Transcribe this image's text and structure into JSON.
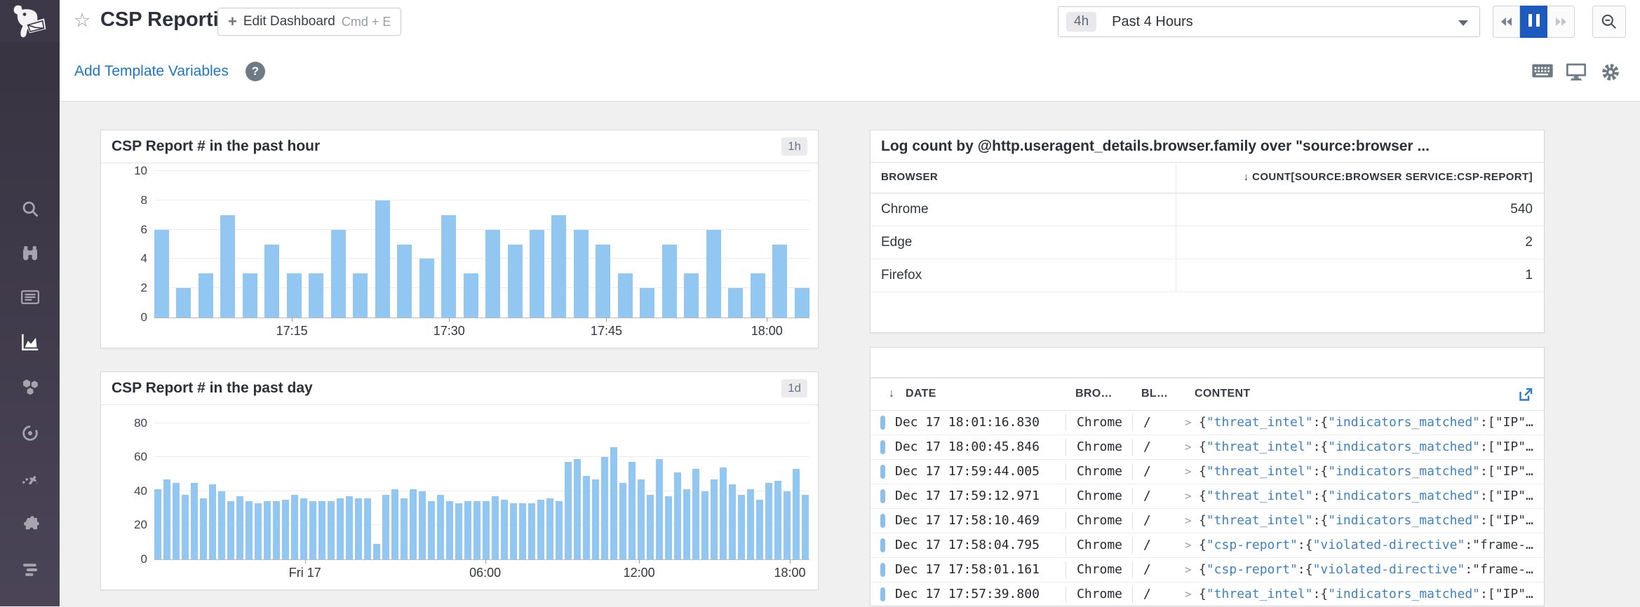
{
  "colors": {
    "accent_link_blue": "#1f77c2",
    "pause_active_blue": "#1d5abe",
    "chart_bar_blue": "#92c7f2",
    "log_key_blue": "#3d82c4",
    "log_level_bar_blue": "#8cc0ea",
    "sidebar_bg": "#3c3847"
  },
  "sidebar": {
    "items": [
      {
        "icon": "search-icon"
      },
      {
        "icon": "watchdog-binoculars-icon"
      },
      {
        "icon": "events-list-icon"
      },
      {
        "icon": "dashboards-chart-icon",
        "active": true
      },
      {
        "icon": "infrastructure-hexagons-icon"
      },
      {
        "icon": "apm-icon"
      },
      {
        "icon": "metrics-gauge-icon"
      },
      {
        "icon": "integrations-puzzle-icon"
      },
      {
        "icon": "logs-icon"
      }
    ]
  },
  "header": {
    "title": "CSP Reporting",
    "edit_button": {
      "plus": "+",
      "label": "Edit Dashboard",
      "shortcut": "Cmd + E"
    },
    "time_picker": {
      "badge": "4h",
      "label": "Past 4 Hours"
    }
  },
  "subheader": {
    "template_link": "Add Template Variables",
    "help": "?"
  },
  "chart_data": [
    {
      "type": "bar",
      "title": "CSP Report # in the past hour",
      "badge": "1h",
      "values": [
        6,
        2,
        3,
        7,
        3,
        5,
        3,
        3,
        6,
        3,
        8,
        5,
        4,
        7,
        3,
        6,
        5,
        6,
        7,
        6,
        5,
        3,
        2,
        5,
        3,
        6,
        2,
        3,
        5,
        2
      ],
      "ylim": [
        0,
        10
      ],
      "yticks": [
        0,
        2,
        4,
        6,
        8,
        10
      ],
      "xticks": [
        {
          "label": "17:15",
          "pos": 0.21
        },
        {
          "label": "17:30",
          "pos": 0.45
        },
        {
          "label": "17:45",
          "pos": 0.69
        },
        {
          "label": "18:00",
          "pos": 0.935
        }
      ],
      "grid": true,
      "legend": false
    },
    {
      "type": "bar",
      "title": "CSP Report # in the past day",
      "badge": "1d",
      "values": [
        41,
        47,
        45,
        38,
        45,
        36,
        44,
        40,
        34,
        37,
        34,
        33,
        34,
        34,
        35,
        38,
        36,
        34,
        34,
        34,
        36,
        37,
        36,
        36,
        9,
        38,
        41,
        36,
        41,
        40,
        34,
        38,
        34,
        33,
        34,
        34,
        34,
        37,
        35,
        33,
        33,
        33,
        35,
        36,
        34,
        57,
        59,
        49,
        47,
        60,
        66,
        45,
        57,
        47,
        38,
        59,
        37,
        51,
        41,
        53,
        40,
        47,
        54,
        44,
        38,
        41,
        35,
        45,
        46,
        40,
        53,
        38
      ],
      "ylim": [
        0,
        86
      ],
      "yticks": [
        0,
        20,
        40,
        60,
        80
      ],
      "xticks": [
        {
          "label": "Fri 17",
          "pos": 0.23
        },
        {
          "label": "06:00",
          "pos": 0.505
        },
        {
          "label": "12:00",
          "pos": 0.74
        },
        {
          "label": "18:00",
          "pos": 0.97
        }
      ],
      "grid": true,
      "legend": false
    }
  ],
  "table_panel": {
    "title": "Log count by @http.useragent_details.browser.family over \"source:browser ...",
    "sort_icon": "↓",
    "columns": [
      "BROWSER",
      "COUNT[SOURCE:BROWSER SERVICE:CSP-REPORT]"
    ],
    "rows": [
      {
        "browser": "Chrome",
        "count": "540"
      },
      {
        "browser": "Edge",
        "count": "2"
      },
      {
        "browser": "Firefox",
        "count": "1"
      }
    ]
  },
  "log_panel": {
    "sort_icon": "↓",
    "columns": {
      "date": "DATE",
      "browser": "BRO…",
      "blocked": "BL…",
      "content": "CONTENT"
    },
    "row_chevron": ">",
    "content_templates": {
      "threat_intel": [
        {
          "text": "{",
          "style": "p"
        },
        {
          "text": "\"threat_intel\"",
          "style": "k"
        },
        {
          "text": ":{",
          "style": "p"
        },
        {
          "text": "\"indicators_matched\"",
          "style": "k"
        },
        {
          "text": ":[",
          "style": "p"
        },
        {
          "text": "\"IP\"",
          "style": "p"
        },
        {
          "text": "…",
          "style": "p"
        }
      ],
      "csp_report": [
        {
          "text": "{",
          "style": "p"
        },
        {
          "text": "\"csp-report\"",
          "style": "k"
        },
        {
          "text": ":{",
          "style": "p"
        },
        {
          "text": "\"violated-directive\"",
          "style": "k"
        },
        {
          "text": ":",
          "style": "p"
        },
        {
          "text": "\"frame-",
          "style": "p"
        },
        {
          "text": "…",
          "style": "p"
        }
      ]
    },
    "rows": [
      {
        "date": "Dec 17 18:01:16.830",
        "browser": "Chrome",
        "path": "/",
        "content": "threat_intel"
      },
      {
        "date": "Dec 17 18:00:45.846",
        "browser": "Chrome",
        "path": "/",
        "content": "threat_intel"
      },
      {
        "date": "Dec 17 17:59:44.005",
        "browser": "Chrome",
        "path": "/",
        "content": "threat_intel"
      },
      {
        "date": "Dec 17 17:59:12.971",
        "browser": "Chrome",
        "path": "/",
        "content": "threat_intel"
      },
      {
        "date": "Dec 17 17:58:10.469",
        "browser": "Chrome",
        "path": "/",
        "content": "threat_intel"
      },
      {
        "date": "Dec 17 17:58:04.795",
        "browser": "Chrome",
        "path": "/",
        "content": "csp_report"
      },
      {
        "date": "Dec 17 17:58:01.161",
        "browser": "Chrome",
        "path": "/",
        "content": "csp_report"
      },
      {
        "date": "Dec 17 17:57:39.800",
        "browser": "Chrome",
        "path": "/",
        "content": "threat_intel"
      }
    ]
  }
}
